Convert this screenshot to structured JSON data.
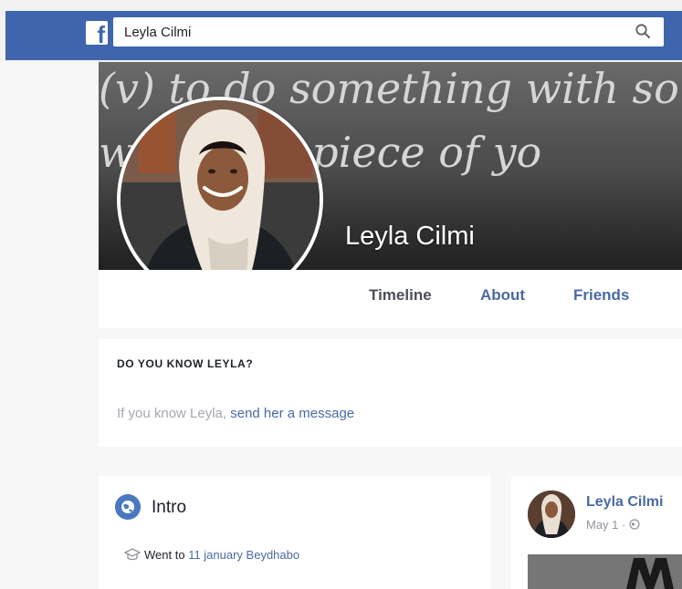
{
  "header": {
    "search_value": "Leyla Cilmi",
    "logo_letter": "f"
  },
  "cover": {
    "line1": "(v) to do something with sou",
    "line2": "w      leave a piece of yo",
    "name": "Leyla Cilmi"
  },
  "tabs": [
    {
      "label": "Timeline"
    },
    {
      "label": "About"
    },
    {
      "label": "Friends"
    }
  ],
  "know": {
    "title": "DO YOU KNOW LEYLA?",
    "text": "If you know Leyla, ",
    "link": "send her a message"
  },
  "intro": {
    "title": "Intro",
    "went_prefix": "Went to ",
    "went_link": "11 january Beydhabo"
  },
  "post": {
    "author": "Leyla Cilmi",
    "date": "May 1 · "
  },
  "colors": {
    "brand": "#3f66ad",
    "link": "#4a6aa5",
    "muted": "#a4a8b0"
  }
}
